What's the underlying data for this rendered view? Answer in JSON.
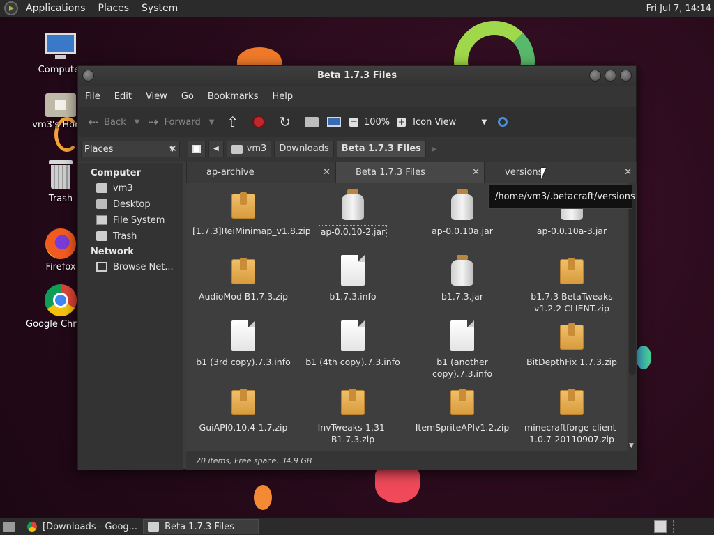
{
  "top_panel": {
    "menus": [
      "Applications",
      "Places",
      "System"
    ],
    "clock": "Fri Jul  7, 14:14"
  },
  "desktop": {
    "icons": [
      {
        "label": "Computer",
        "icon": "computer-icon"
      },
      {
        "label": "vm3's Home",
        "icon": "home-folder-icon"
      },
      {
        "label": "Trash",
        "icon": "trash-icon"
      },
      {
        "label": "Firefox",
        "icon": "firefox-icon"
      },
      {
        "label": "Google Chrome",
        "icon": "chrome-icon"
      }
    ]
  },
  "window": {
    "title": "Beta 1.7.3 Files",
    "menu": [
      "File",
      "Edit",
      "View",
      "Go",
      "Bookmarks",
      "Help"
    ],
    "toolbar": {
      "back": "Back",
      "forward": "Forward",
      "zoom": "100%",
      "view_mode": "Icon View"
    },
    "places_label": "Places",
    "breadcrumbs": [
      "vm3",
      "Downloads",
      "Beta 1.7.3 Files"
    ],
    "sidebar": {
      "computer_heading": "Computer",
      "computer_items": [
        {
          "label": "vm3",
          "icon": "home-icon"
        },
        {
          "label": "Desktop",
          "icon": "desktop-icon"
        },
        {
          "label": "File System",
          "icon": "drive-icon"
        },
        {
          "label": "Trash",
          "icon": "trash-icon"
        }
      ],
      "network_heading": "Network",
      "network_items": [
        {
          "label": "Browse Net...",
          "icon": "network-icon"
        }
      ]
    },
    "tabs": [
      {
        "label": "ap-archive",
        "active": false
      },
      {
        "label": "Beta 1.7.3 Files",
        "active": true
      },
      {
        "label": "versions",
        "active": false
      }
    ],
    "tooltip": "/home/vm3/.betacraft/versions",
    "files": [
      {
        "name": "[1.7.3]ReiMinimap_v1.8.zip",
        "type": "zip"
      },
      {
        "name": "ap-0.0.10-2.jar",
        "type": "jar",
        "selected": true
      },
      {
        "name": "ap-0.0.10a.jar",
        "type": "jar"
      },
      {
        "name": "ap-0.0.10a-3.jar",
        "type": "jar"
      },
      {
        "name": "AudioMod B1.7.3.zip",
        "type": "zip"
      },
      {
        "name": "b1.7.3.info",
        "type": "doc"
      },
      {
        "name": "b1.7.3.jar",
        "type": "jar"
      },
      {
        "name": "b1.7.3 BetaTweaks v1.2.2 CLIENT.zip",
        "type": "zip"
      },
      {
        "name": "b1 (3rd copy).7.3.info",
        "type": "doc"
      },
      {
        "name": "b1 (4th copy).7.3.info",
        "type": "doc"
      },
      {
        "name": "b1 (another copy).7.3.info",
        "type": "doc"
      },
      {
        "name": "BitDepthFix 1.7.3.zip",
        "type": "zip"
      },
      {
        "name": "GuiAPI0.10.4-1.7.zip",
        "type": "zip"
      },
      {
        "name": "InvTweaks-1.31-B1.7.3.zip",
        "type": "zip"
      },
      {
        "name": "ItemSpriteAPIv1.2.zip",
        "type": "zip"
      },
      {
        "name": "minecraftforge-client-1.0.7-20110907.zip",
        "type": "zip"
      }
    ],
    "status": "20 items, Free space: 34.9 GB"
  },
  "taskbar": {
    "tasks": [
      {
        "label": "[Downloads - Goog...",
        "icon": "chrome-icon",
        "active": false
      },
      {
        "label": "Beta 1.7.3 Files",
        "icon": "folder-icon",
        "active": true
      }
    ]
  }
}
